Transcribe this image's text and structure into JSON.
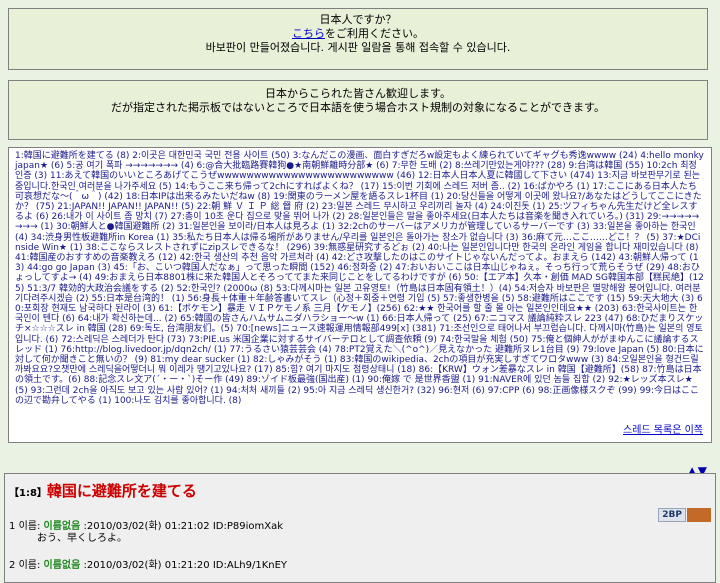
{
  "notice_jp": {
    "line1": "日本人ですか？",
    "link": "こちら",
    "line2_rest": "をご利用ください。",
    "line3": "바보판이 만들어졌습니다. 게시판 일람을 통해 접속할 수 있습니다."
  },
  "notice_welcome": {
    "line1": "日本からこられた皆さん歓迎します。",
    "line2": "だが指定された掲示板ではないところで日本語を使う場合ホスト規制の対象になることができます。"
  },
  "threads": [
    "1:韓国に避難所を建てる (8)",
    "2:이곳은 대한민국 국민 전용 사이트 (50)",
    "3:なんだこの漫画、面白すぎだろw設定もよく練られていてギャグも秀逸wwww (24)",
    "4:hello monky japan★ (6)",
    "5:공 여기 폭파 →→→→→→→ (4)",
    "6:@合大批臨路賽韓狗●★南朝鮮離時分部★ (6)",
    "7:무한 도배 (2)",
    "8:쓰레기만있는게야??? (28)",
    "9:台湾は韓国 (55)",
    "10:2ch 최정인증 (3)",
    "11:あえて韓国のいいところあげてこうぜwwwwwwwwwwwwwwwwwwwwwwww (46)",
    "12:日本人日本人夏に韓國して下さい (474)",
    "13:지금 바보판무기로 된는중입니다.한국인 여러분을 나가주세요 (5)",
    "14:もうここ来ち帰って2chにすればよくね？ (17)",
    "15:이번 기회에 스레드 저버 좀.. (2)",
    "16:ばかやろ (1)",
    "17:ここにある日本人たち可哀想だな〜(＾ω＾) (42)",
    "18:日本IPは出来るみたいだねw (8)",
    "19:関東のラーメン屋を語るスレ1杯目 (1)",
    "20:당신들을 어떻게 이곳에 왔나요?/あなたはどうしてここにきたか？ (75)",
    "21:JAPAN!! JAPAN!! JAPAN!! (5)",
    "22:朝 鮮 Ｖ Ｉ Ｐ 総 督 府 (2)",
    "23:일본 스레드 무시하고 우리끼리 놀자 (4)",
    "24:이진돗 (1)",
    "25:ツフィちゃん先生だけど全レスするよ (6)",
    "26:내가 이 사이트 좀 망치 (7)",
    "27:총이 10초 운다 집으로 맞을 뛰어 나가 (2)",
    "28:일본인들은 말을 좋아주세요(日本人たちは音楽を聞き入れていろ。) (31)",
    "29:→→→→→→→→ (1)",
    "30:朝鮮人と●韓国避難所 (2)",
    "31:일본인을 보이라/日本人は見ろよ (1)",
    "32:2chのサーバーはアメリカが管理しているサーバーです (3)",
    "33:일본을 좋아하는 한국인 (4)",
    "34:渋身男性板避難所in Korea (1)",
    "35:私たち日本人は帰る場所がありません/우리를 일본인은 돌아가는 장소가 없습니다 (3)",
    "36:麻て元…ここ……どこ！？ (5)",
    "37:★DCinside Win★ (1)",
    "38:ここならスレストされずにzipスレできるな！ (296)",
    "39:無惑星研究するどぉ (2)",
    "40:나는 일본인입니다만 한국의 온라인 게임을 합니다 재미있습니다 (8)",
    "41:韓国産のおすすめの音楽教えろ (12)",
    "42:한국 생산의 추천 음악 가르쳐라 (4)",
    "42:どさ攻撃したのはこのサイトじゃないんだってよ。おまえら (142)",
    "43:朝鮮人帰って (13)",
    "44:go go Japan (3)",
    "45:「お、こいつ韓国人だなぁ」って思った瞬間 (152)",
    "46:정화중 (2)",
    "47:おいおいここは日本山じゃねぇ。そっち行って荒らそうぜ (29)",
    "48:おひょっしてすよ→ (4)",
    "49:おまえら日本8801株に来た韓国人とそろっててまた来同じことをしてるわけですが (6)",
    "50:【エア本】久本・創価 MAD SG韓国本部【糕民絶】(125)",
    "51:3/7 韓効的大政治会議をする (2)",
    "52:한국인? (2000ω (8)",
    "53:다께시마는 일본 고유영토!（竹島は日本固有領土！）(4)",
    "54:저승자 바보판은 멸망해왕 붕어입니다. 여러분 기다려주시겠습 (2)",
    "55:日本是台湾的！ (1)",
    "56:身長＋体重＋年齢答書いてスレ（心정＋회중＋연령 기입 (5)",
    "57:좋생한병을 (5)",
    "58:避難所はここです (15)",
    "59:天大地大 (3)",
    "60:포회장 현재도 남국하다 된라이 (3)",
    "61:【ボケモン】暴走 ＶＩＰケモノ系 三月【ケモノ】(256)",
    "62:★★ 한국어를 할 줄 몰 아는 일본인인데요★★ (203)",
    "63:한국사이트는 한국인이 텐다 (6)",
    "64:내가 확신하는데... (2)",
    "65:韓國の皆さんハムサムニダハラショー〜w (1)",
    "66:日本人帰って (25)",
    "67:ニコマス 議論純粋スレ 223 (47)",
    "68:ひだまりスケッチ×☆☆☆スレ in 韓国 (28)",
    "69:독도, 台湾朋友们。(5)",
    "70:[news]ニュース速報運用情報部499[x] (381)",
    "71:조선인으로 태어나서 부끄럽습니다. 다께시마(竹島)는 일본의 영토입니다. (6)",
    "72:스레딕은 스레더가 탄다 (73)",
    "73:PIE.us 米国企業に対するサイバーテロとして調査依頼 (9)",
    "74:한국말을 체험 (50)",
    "75:俺と個紳人ががまゆんこに議論するスレッド (1)",
    "76:http://blog.livedoor.jp/dqn2ch/ (1)",
    "77:うるさい猿芸芸会 (4)",
    "78:PT2覚えた＼(^o^)／見えなかった 避難所ヌレ1台目 (9)",
    "79:love Japan (5)",
    "80:日本に対して何か聞きこと無いの？ (9)",
    "81:my dear sucker (1)",
    "82:しゃみがそう (1)",
    "83:韓国のwikipedia、2chの項目が充実しすぎてワロタwww (3)",
    "84:오일본인을 형건드릴까봐요요?오챗만에 스레딕을어떻더니 뭐 이레가 땡기고있나요? (17)",
    "85:힘? 여기 마지도 점령상태니 (18)",
    "86:【KRW】ウォン差暴なスレ in 韓国【避難所】(58)",
    "87:竹島は日本の領土です。(6)",
    "88:記念スレ文ア(´・ー・`)そー作 (49)",
    "89:ゾイド板最強(国出産) (1)",
    "90:俺嫁 で 是世界香盟 (1)",
    "91:NAVER에 있던 놈들 집합 (2)",
    "92:★レッズ本スレ★ (5)",
    "93:그런데 2ch을 아직도 보고 있는 사람 있어? (1)",
    "94:처처 새끼들 (2)",
    "95:아 지금 스레딕 생신한거? (32)",
    "96:현저 (6)",
    "97:CPP (6)",
    "98:正画像様スクぞ (99)",
    "99:今日はここの辺で勘弁してやる (1)",
    "100:나도 김치를 좋아합니다. (8)"
  ],
  "thread_list_more": "스레드 목록은 이쪽",
  "nav_arrows": "▲▼",
  "post_header": {
    "num": "【1:8】",
    "title": "韓国に避難所を建てる"
  },
  "badges": {
    "label": "2BP",
    "color": "#c46a28"
  },
  "posts": [
    {
      "num": "1",
      "label": "이름:",
      "name": "이름없음",
      "date": ":2010/03/02(화) 01:21:02",
      "id": "ID:P89iomXak",
      "body": "おう、早くしろよ。"
    },
    {
      "num": "2",
      "label": "이름:",
      "name": "이름없음",
      "date": ":2010/03/02(화) 01:21:20",
      "id": "ID:ALh9/1KnEY",
      "body": ""
    }
  ]
}
